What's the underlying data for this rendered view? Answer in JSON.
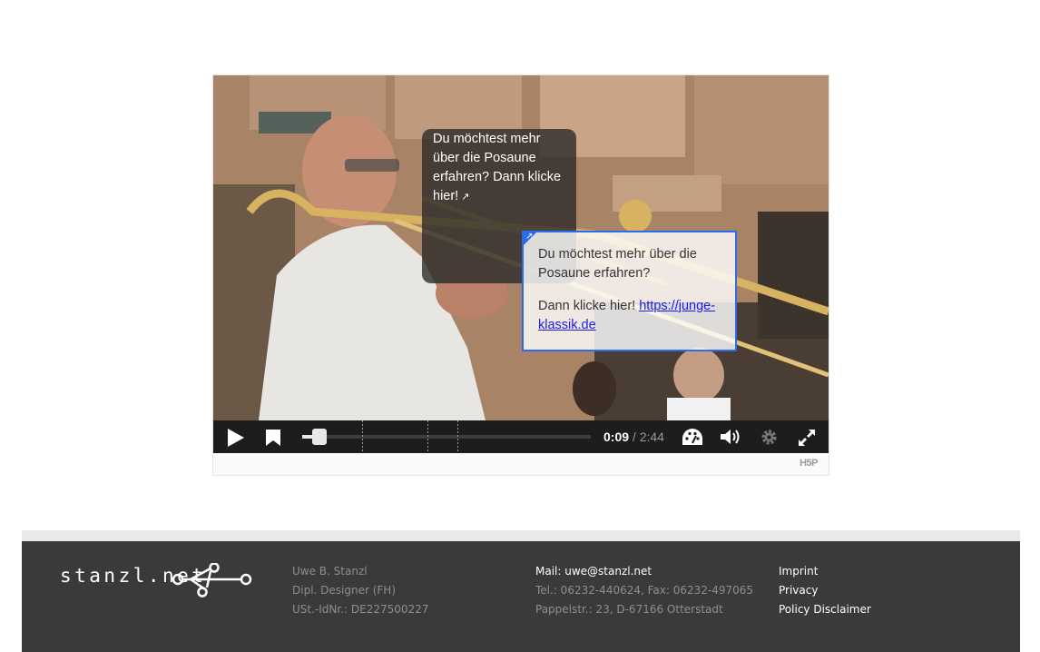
{
  "player": {
    "hotspot_text": "Du möchtest mehr über die Posaune erfahren? Dann klicke hier!",
    "popup": {
      "line1": "Du möchtest mehr über die Posaune erfahren?",
      "line2_prefix": "Dann klicke hier! ",
      "link": "https://junge-klassik.de"
    },
    "controls": {
      "current_time": "0:09",
      "separator": " / ",
      "duration": "2:44",
      "progress_fraction": 0.055
    },
    "brand": "H5P"
  },
  "footer": {
    "logo_text": "stanzl.net",
    "col1": [
      "Uwe B. Stanzl",
      "Dipl. Designer (FH)",
      "USt.-IdNr.: DE227500227"
    ],
    "col2": [
      "Mail: uwe@stanzl.net",
      "Tel.: 06232-440624, Fax: 06232-497065",
      "Pappelstr.: 23, D-67166 Otterstadt"
    ],
    "links": [
      "Imprint",
      "Privacy",
      "Policy Disclaimer"
    ]
  },
  "colors": {
    "accent": "#2b6bf0",
    "footer_bg": "#3a3a3a",
    "control_bar": "#1d1d1d"
  }
}
